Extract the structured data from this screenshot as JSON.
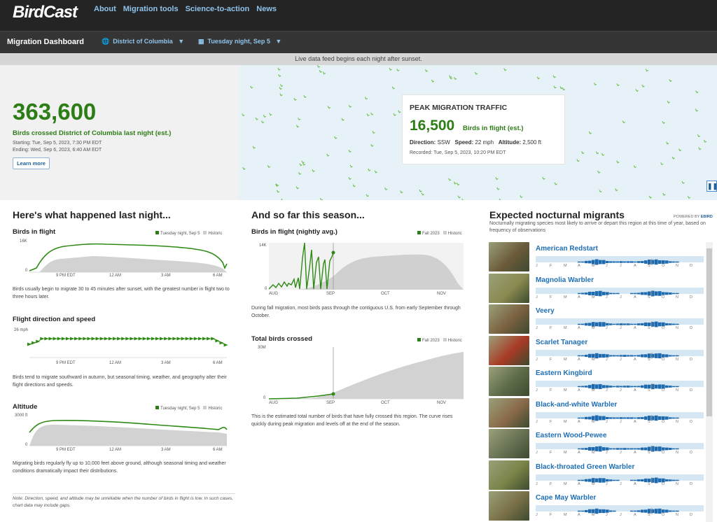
{
  "app": {
    "logo": "BirdCast"
  },
  "topnav": [
    "About",
    "Migration tools",
    "Science-to-action",
    "News"
  ],
  "dashbar": {
    "title": "Migration Dashboard",
    "region": "District of Columbia",
    "date": "Tuesday night, Sep 5",
    "region_icon": "globe-icon",
    "date_icon": "calendar-icon"
  },
  "notice": "Live data feed begins each night after sunset.",
  "hero": {
    "count": "363,600",
    "subtitle": "Birds crossed District of Columbia last night (est.)",
    "starting": "Starting: Tue, Sep 5, 2023, 7:30 PM EDT",
    "ending": "Ending: Wed, Sep 6, 2023, 6:40 AM EDT",
    "learn_more": "Learn more"
  },
  "peak": {
    "title": "PEAK MIGRATION TRAFFIC",
    "count": "16,500",
    "unit": "Birds in flight (est.)",
    "direction_label": "Direction:",
    "direction": "SSW",
    "speed_label": "Speed:",
    "speed": "22 mph",
    "altitude_label": "Altitude:",
    "altitude": "2,500 ft",
    "recorded": "Recorded: Tue, Sep 5, 2023, 10:20 PM EDT"
  },
  "last_night": {
    "heading": "Here's what happened last night...",
    "legend_current": "Tuesday night, Sep 5",
    "legend_hist": "Historic",
    "x_ticks": [
      "9 PM EDT",
      "12 AM",
      "3 AM",
      "6 AM"
    ],
    "birds": {
      "title": "Birds in flight",
      "ymax": "16K",
      "ymin": "0",
      "desc": "Birds usually begin to migrate 30 to 45 minutes after sunset, with the greatest number in flight two to three hours later."
    },
    "direction": {
      "title": "Flight direction and speed",
      "ymax": "26 mph",
      "desc": "Birds tend to migrate southward in autumn, but seasonal timing, weather, and geography alter their flight directions and speeds."
    },
    "altitude": {
      "title": "Altitude",
      "ymax": "3000 ft",
      "ymin": "0",
      "desc": "Migrating birds regularly fly up to 10,000 feet above ground, although seasonal timing and weather conditions dramatically impact their distributions."
    },
    "note": "Note: Direction, speed, and altitude may be unreliable when the number of birds in flight is low. In such cases, chart data may include gaps."
  },
  "season": {
    "heading": "And so far this season...",
    "legend_current": "Fall 2023",
    "legend_hist": "Historic",
    "x_ticks": [
      "AUG",
      "SEP",
      "OCT",
      "NOV"
    ],
    "avg": {
      "title": "Birds in flight (nightly avg.)",
      "ymax": "14K",
      "ymin": "0",
      "desc": "During fall migration, most birds pass through the contiguous U.S. from early September through October."
    },
    "total": {
      "title": "Total birds crossed",
      "ymax": "30M",
      "ymin": "0",
      "desc": "This is the estimated total number of birds that have fully crossed this region. The curve rises quickly during peak migration and levels off at the end of the season."
    }
  },
  "migrants": {
    "heading": "Expected nocturnal migrants",
    "powered": "POWERED BY",
    "powered_brand": "EBIRD",
    "subtitle": "Nocturnally migrating species most likely to arrive or depart this region at this time of year, based on frequency of observations",
    "months": [
      "J",
      "F",
      "M",
      "A",
      "M",
      "J",
      "J",
      "A",
      "S",
      "O",
      "N",
      "D"
    ],
    "species": [
      {
        "name": "American Redstart",
        "color": "#6b5a3a"
      },
      {
        "name": "Magnolia Warbler",
        "color": "#8a8a50"
      },
      {
        "name": "Veery",
        "color": "#7a6040"
      },
      {
        "name": "Scarlet Tanager",
        "color": "#a83a24"
      },
      {
        "name": "Eastern Kingbird",
        "color": "#5c6a48"
      },
      {
        "name": "Black-and-white Warbler",
        "color": "#8a6a4a"
      },
      {
        "name": "Eastern Wood-Pewee",
        "color": "#667052"
      },
      {
        "name": "Black-throated Green Warbler",
        "color": "#7a8448"
      },
      {
        "name": "Cape May Warbler",
        "color": "#7a7048"
      }
    ]
  }
}
